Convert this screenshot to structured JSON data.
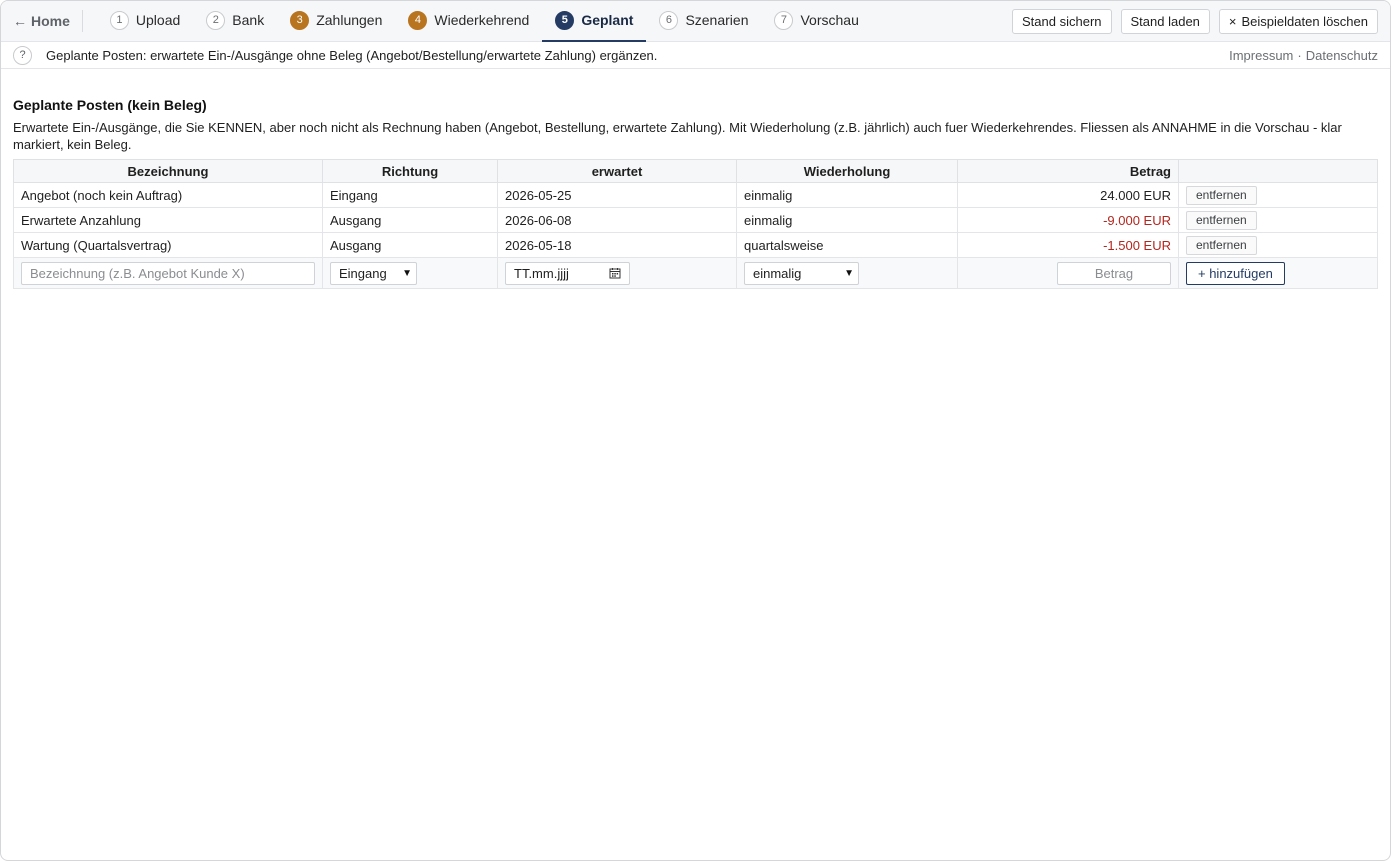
{
  "nav": {
    "home_label": "Home",
    "home_arrow": "←",
    "steps": [
      {
        "num": "1",
        "label": "Upload",
        "state": "todo"
      },
      {
        "num": "2",
        "label": "Bank",
        "state": "todo"
      },
      {
        "num": "3",
        "label": "Zahlungen",
        "state": "done"
      },
      {
        "num": "4",
        "label": "Wiederkehrend",
        "state": "done"
      },
      {
        "num": "5",
        "label": "Geplant",
        "state": "active"
      },
      {
        "num": "6",
        "label": "Szenarien",
        "state": "todo"
      },
      {
        "num": "7",
        "label": "Vorschau",
        "state": "todo"
      }
    ],
    "actions": {
      "save_label": "Stand sichern",
      "load_label": "Stand laden",
      "clear_icon": "×",
      "clear_label": "Beispieldaten löschen"
    }
  },
  "hint": {
    "icon": "?",
    "text": "Geplante Posten: erwartete Ein-/Ausgänge ohne Beleg (Angebot/Bestellung/erwartete Zahlung) ergänzen.",
    "impressum": "Impressum",
    "separator": "·",
    "datenschutz": "Datenschutz"
  },
  "section": {
    "title": "Geplante Posten (kein Beleg)",
    "description": "Erwartete Ein-/Ausgänge, die Sie KENNEN, aber noch nicht als Rechnung haben (Angebot, Bestellung, erwartete Zahlung). Mit Wiederholung (z.B. jährlich) auch fuer Wiederkehrendes. Fliessen als ANNAHME in die Vorschau - klar markiert, kein Beleg."
  },
  "table": {
    "headers": {
      "name": "Bezeichnung",
      "direction": "Richtung",
      "expected": "erwartet",
      "repeat": "Wiederholung",
      "amount": "Betrag"
    },
    "rows": [
      {
        "name": "Angebot (noch kein Auftrag)",
        "direction": "Eingang",
        "expected": "2026-05-25",
        "repeat": "einmalig",
        "amount": "24.000 EUR",
        "sign": "pos",
        "remove_label": "entfernen"
      },
      {
        "name": "Erwartete Anzahlung",
        "direction": "Ausgang",
        "expected": "2026-06-08",
        "repeat": "einmalig",
        "amount": "-9.000 EUR",
        "sign": "neg",
        "remove_label": "entfernen"
      },
      {
        "name": "Wartung (Quartalsvertrag)",
        "direction": "Ausgang",
        "expected": "2026-05-18",
        "repeat": "quartalsweise",
        "amount": "-1.500 EUR",
        "sign": "neg",
        "remove_label": "entfernen"
      }
    ],
    "add": {
      "name_placeholder": "Bezeichnung (z.B. Angebot Kunde X)",
      "direction_value": "Eingang",
      "date_placeholder": "TT.mm.jjjj",
      "repeat_value": "einmalig",
      "amount_placeholder": "Betrag",
      "add_label": "+ hinzufügen"
    }
  },
  "colors": {
    "accent": "#243c64",
    "done_step": "#b8741f",
    "negative": "#b3261e"
  }
}
